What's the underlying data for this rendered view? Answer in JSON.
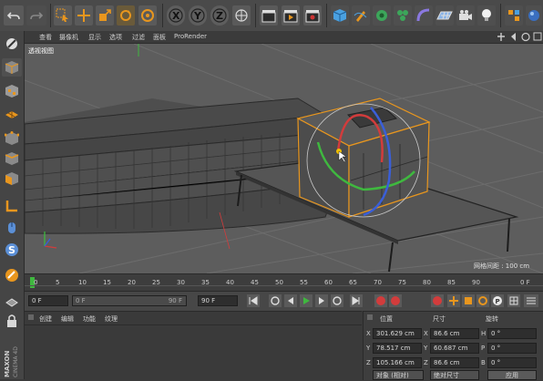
{
  "viewport": {
    "menu": [
      "查看",
      "摄像机",
      "显示",
      "选项",
      "过滤",
      "面板",
      "ProRender"
    ],
    "view_name": "透视视图",
    "grid_spacing": "网格间距 : 100 cm"
  },
  "timeline": {
    "ticks": [
      "0",
      "5",
      "10",
      "15",
      "20",
      "25",
      "30",
      "35",
      "40",
      "45",
      "50",
      "55",
      "60",
      "65",
      "70",
      "75",
      "80",
      "85",
      "90"
    ],
    "frame_label": "0 F"
  },
  "transport": {
    "current_frame": "0 F",
    "range_start": "0 F",
    "range_end": "90 F",
    "end_frame": "90 F"
  },
  "material_panel": {
    "menu": [
      "创建",
      "编辑",
      "功能",
      "纹理"
    ]
  },
  "coordinates": {
    "headers": {
      "position": "位置",
      "size": "尺寸",
      "rotation": "旋转"
    },
    "rows": [
      {
        "axis": "X",
        "position": "301.629 cm",
        "size_axis": "X",
        "size": "86.6 cm",
        "rot_axis": "H",
        "rotation": "0 °"
      },
      {
        "axis": "Y",
        "position": "78.517 cm",
        "size_axis": "Y",
        "size": "60.687 cm",
        "rot_axis": "P",
        "rotation": "0 °"
      },
      {
        "axis": "Z",
        "position": "105.166 cm",
        "size_axis": "Z",
        "size": "86.6 cm",
        "rot_axis": "B",
        "rotation": "0 °"
      }
    ],
    "mode_dropdown": "对象 (相对)",
    "size_dropdown": "绝对尺寸",
    "apply_button": "应用"
  },
  "brand": {
    "maxon": "MAXON",
    "product": "CINEMA 4D"
  },
  "colors": {
    "accent_orange": "#e8961e",
    "axis_red": "#d23c3c",
    "axis_green": "#3fb83f",
    "axis_blue": "#3a5fd8"
  }
}
